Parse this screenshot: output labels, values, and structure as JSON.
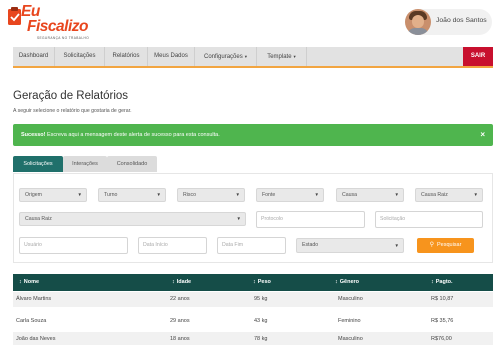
{
  "header": {
    "logo_line1": "Eu",
    "logo_line2": "Fiscalizo",
    "logo_tagline": "SEGURANÇA NO TRABALHO",
    "user_name": "João dos Santos"
  },
  "nav": {
    "items": [
      {
        "label": "Dashboard"
      },
      {
        "label": "Solicitações"
      },
      {
        "label": "Relatórios"
      },
      {
        "label": "Meus Dados"
      },
      {
        "label": "Configurações",
        "caret": "▾"
      },
      {
        "label": "Template",
        "caret": "▾"
      }
    ],
    "logout_label": "SAIR"
  },
  "page": {
    "title": "Geração de Relatórios",
    "subtitle": "A seguir selecione o relatório que gostaria de gerar."
  },
  "alert": {
    "strong": "Sucesso!",
    "message": " Escreva aqui a mensagem deste alerta de sucesso para esta consulta.",
    "close": "×"
  },
  "tabs": [
    {
      "label": "Solicitações",
      "active": true
    },
    {
      "label": "Interações",
      "active": false
    },
    {
      "label": "Consolidado",
      "active": false
    }
  ],
  "filters": {
    "selects_row1": [
      "Origem",
      "Turno",
      "Risco",
      "Fonte",
      "Causa",
      "Causa Raiz"
    ],
    "select_row2": "Causa Raiz",
    "protocolo_placeholder": "Protocolo",
    "solicitacao_placeholder": "Solicitação",
    "usuario_placeholder": "Usuário",
    "data_inicio_placeholder": "Data Início",
    "data_fim_placeholder": "Data Fim",
    "estado_label": "Estado",
    "arrow": "▼",
    "search_label": "Pesquisar",
    "search_icon": "⚲"
  },
  "table": {
    "sort_icon": "↕",
    "headers": [
      "Nome",
      "Idade",
      "Peso",
      "Gênero",
      "Pagto."
    ],
    "rows": [
      [
        "Álvaro Martins",
        "22 anos",
        "95 kg",
        "Masculino",
        "R$ 10,87"
      ],
      [
        "Carla Souza",
        "29 anos",
        "43 kg",
        "Feminino",
        "R$ 35,76"
      ],
      [
        "João das Neves",
        "18 anos",
        "78 kg",
        "Masculino",
        "R$76,00"
      ]
    ]
  },
  "colors": {
    "brand": "#e8461e",
    "nav_accent": "#f2a541",
    "logout": "#c8102e",
    "success": "#4fb54e",
    "tab_active": "#20706b",
    "table_header": "#154d48",
    "search_button": "#f7941d"
  }
}
